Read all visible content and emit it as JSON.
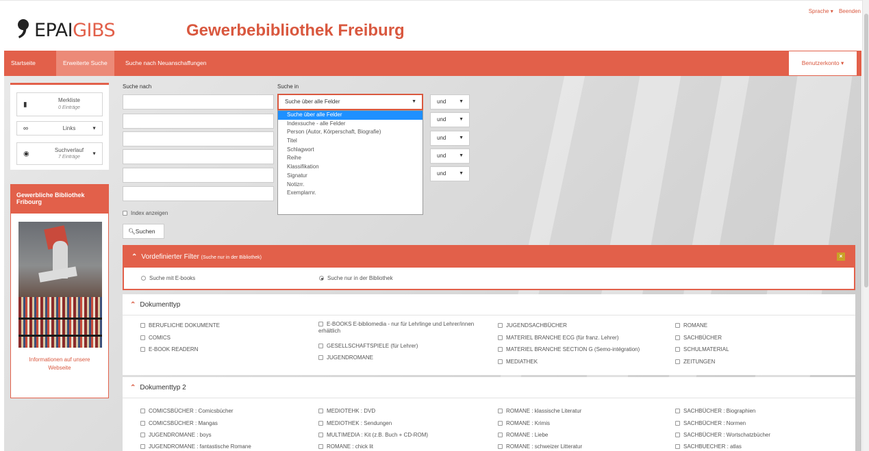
{
  "header": {
    "logo_part1": "EPAI",
    "logo_part2": "GIBS",
    "site_title": "Gewerbebibliothek Freiburg",
    "language_menu": "Sprache ▾",
    "logout_link": "Beenden"
  },
  "nav": {
    "items": [
      "Startseite",
      "Erweiterte Suche",
      "Suche nach Neuanschaffungen"
    ],
    "account_label": "Benutzerkonto ▾"
  },
  "sidebar": {
    "watchlist_title": "Merkliste",
    "watchlist_count": "0 Einträge",
    "links_label": "Links",
    "history_title": "Suchverlauf",
    "history_count": "7 Einträge",
    "library_title": "Gewerbliche Bibliothek Fribourg",
    "info_link": "Informationen auf unsere Webseite"
  },
  "search": {
    "label_search_for": "Suche nach",
    "label_search_in": "Suche in",
    "field_selected": "Suche über alle Felder",
    "operator": "und",
    "dropdown_options": [
      "Suche über alle Felder",
      "Indexsuche - alle Felder",
      "Person (Autor, Körperschaft, Biografie)",
      "Titel",
      "Schlagwort",
      "Reihe",
      "Klassifikation",
      "Signatur",
      "Notizrr.",
      "Exemplarnr."
    ],
    "index_label": "Index anzeigen",
    "search_button": "Suchen"
  },
  "filter_predefined": {
    "title": "Vordefinierter Filter",
    "subtitle": "(Suche nur in der Bibliothek)",
    "option_ebooks": "Suche mit E-books",
    "option_library": "Suche nur in der Bibliothek"
  },
  "doctype": {
    "title": "Dokumenttyp",
    "col1": [
      "BERUFLICHE DOKUMENTE",
      "COMICS",
      "E-BOOK READERN"
    ],
    "col2": [
      "E-BOOKS E-bibliomedia - nur für Lehrlinge und Lehrer/innen erhältlich",
      "GESELLSCHAFTSPIELE (für Lehrer)",
      "JUGENDROMANE"
    ],
    "col3": [
      "JUGENDSACHBÜCHER",
      "MATERIEL BRANCHE ECG (für franz. Lehrer)",
      "MATERIEL BRANCHE SECTION G (Semo-intégration)",
      "MEDIATHEK"
    ],
    "col4": [
      "ROMANE",
      "SACHBÜCHER",
      "SCHULMATERIAL",
      "ZEITUNGEN"
    ]
  },
  "doctype2": {
    "title": "Dokumenttyp 2",
    "col1": [
      "COMICSBÜCHER : Comicsbücher",
      "COMICSBÜCHER : Mangas",
      "JUGENDROMANE : boys",
      "JUGENDROMANE : fantastische Romane"
    ],
    "col2": [
      "MEDIOTEHK : DVD",
      "MEDIOTHEK : Sendungen",
      "MULTIMEDIA : Kit (z.B. Buch + CD-ROM)",
      "ROMANE : chick lit"
    ],
    "col3": [
      "ROMANE : klassische Literatur",
      "ROMANE : Krimis",
      "ROMANE : Liebe",
      "ROMANE : schweizer Litteratur"
    ],
    "col4": [
      "SACHBÜCHER : Biographien",
      "SACHBÜCHER : Normen",
      "SACHBÜCHER : Wortschatzbücher",
      "SACHBUECHER : atlas"
    ]
  },
  "colors": {
    "accent": "#e2604a",
    "dropdown_highlight": "#1e90ff"
  }
}
